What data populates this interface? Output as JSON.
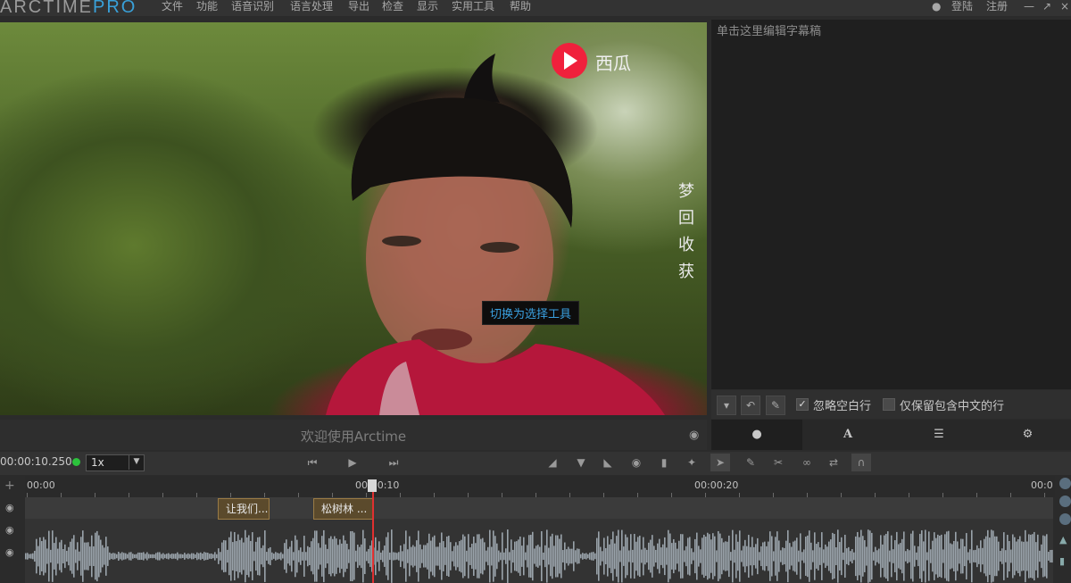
{
  "app": {
    "title_main": "ARCTIME",
    "title_pro": "PRO"
  },
  "menu": [
    "文件",
    "功能",
    "语音识别",
    "语言处理",
    "导出",
    "检查",
    "显示",
    "实用工具",
    "帮助"
  ],
  "account": {
    "login": "登陆",
    "register": "注册"
  },
  "video": {
    "tooltip": "切换为选择工具",
    "welcome": "欢迎使用Arctime",
    "xigua_text": "西瓜",
    "watermark_text": "梦回收获"
  },
  "editor": {
    "placeholder": "单击这里编辑字幕稿"
  },
  "options": {
    "ignore_blank_lines": "忽略空白行",
    "ignore_blank_checked": true,
    "keep_chinese_only": "仅保留包含中文的行",
    "keep_chinese_checked": false
  },
  "transport": {
    "timecode": "00:00:10.250",
    "speed": "1x"
  },
  "ruler": {
    "labels": [
      "00:00",
      "00:00:10",
      "00:00:20",
      "00:0"
    ]
  },
  "subtitles": [
    {
      "text": "让我们..."
    },
    {
      "text": "松树林  ..."
    }
  ],
  "colors": {
    "accent": "#39a0d8",
    "playhead": "#e03030",
    "status_dot": "#2cc33c",
    "segment": "#5b4a2c"
  },
  "icons": {
    "eye": "eye-icon",
    "chat": "chat-icon",
    "font": "font-icon",
    "list": "list-icon",
    "gear": "gear-icon"
  }
}
